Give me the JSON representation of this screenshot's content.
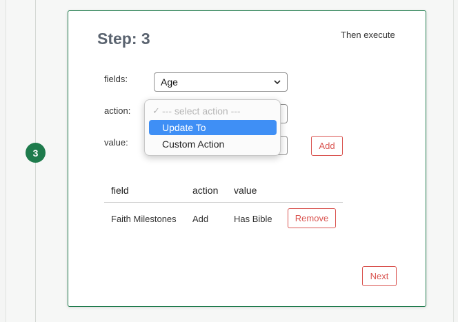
{
  "step": {
    "badge_number": "3",
    "title": "Step: 3",
    "subtitle": "Then execute"
  },
  "form": {
    "fields_label": "fields:",
    "fields_value": "Age",
    "action_label": "action:",
    "value_label": "value:",
    "add_button": "Add"
  },
  "action_dropdown": {
    "options": [
      {
        "label": "--- select action ---",
        "state": "disabled",
        "checked": true
      },
      {
        "label": "Update To",
        "state": "highlighted"
      },
      {
        "label": "Custom Action",
        "state": "normal"
      }
    ],
    "checkmark_glyph": "✓"
  },
  "table": {
    "columns": [
      "field",
      "action",
      "value"
    ],
    "rows": [
      {
        "field": "Faith Milestones",
        "action": "Add",
        "value": "Has Bible",
        "button": "Remove"
      }
    ]
  },
  "footer": {
    "next_button": "Next"
  },
  "colors": {
    "accent_green": "#1e7b4c",
    "danger_red": "#d9534f",
    "highlight_blue": "#3f8ff5"
  }
}
